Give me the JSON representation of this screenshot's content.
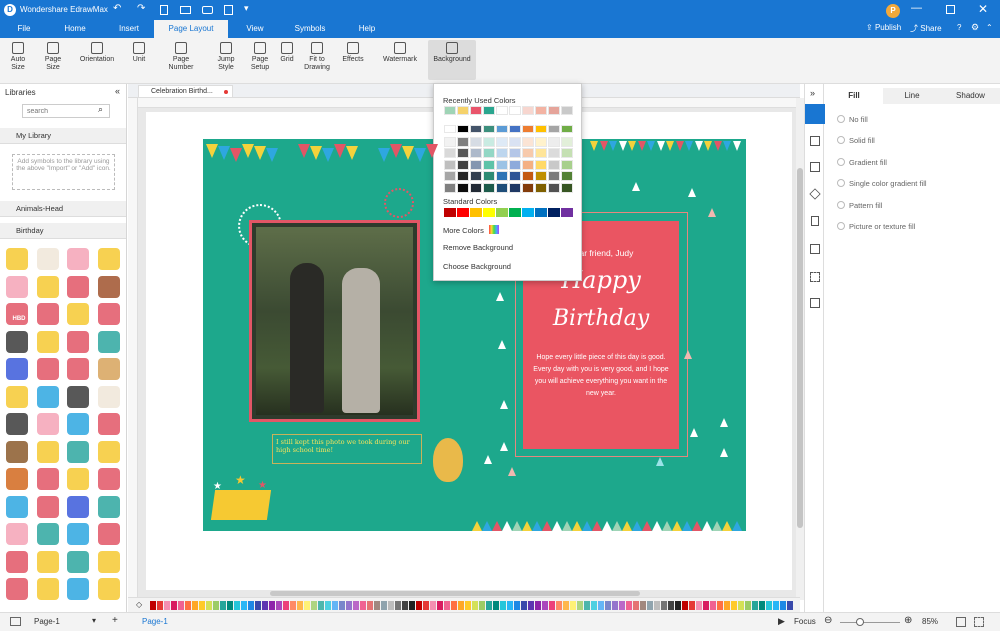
{
  "app": {
    "title": "Wondershare EdrawMax",
    "user_initial": "P",
    "publish": "Publish",
    "share": "Share"
  },
  "menu": {
    "file": "File",
    "home": "Home",
    "insert": "Insert",
    "page_layout": "Page Layout",
    "view": "View",
    "symbols": "Symbols",
    "help": "Help"
  },
  "ribbon": {
    "auto_size": "Auto Size",
    "page_size": "Page Size",
    "orientation": "Orientation",
    "unit": "Unit",
    "page_number": "Page Number",
    "jump_style": "Jump Style",
    "page_setup": "Page Setup",
    "grid": "Grid",
    "fit_to_drawing": "Fit to Drawing",
    "effects": "Effects",
    "watermark": "Watermark",
    "background": "Background"
  },
  "libraries": {
    "title": "Libraries",
    "search_placeholder": "search",
    "my_library": "My Library",
    "my_library_hint": "Add symbols to the library using the above \"Import\" or \"Add\" icon.",
    "animals_head": "Animals-Head",
    "birthday": "Birthday",
    "hbd": "HBD"
  },
  "tab": {
    "name": "Celebration Birthd..."
  },
  "dropdown": {
    "recently_used": "Recently Used Colors",
    "standard": "Standard Colors",
    "more_colors": "More Colors",
    "remove_background": "Remove Background",
    "choose_background": "Choose Background",
    "recent_colors": [
      "#9fd4b6",
      "#f5d26b",
      "#e9556b",
      "#2aa68f",
      "#ffffff",
      "#ffffff",
      "#f7d6cf",
      "#f3b3a3",
      "#e5a49a",
      "#c9c9c9"
    ],
    "standard_colors": [
      "#c00000",
      "#ff0000",
      "#ffc000",
      "#ffff00",
      "#92d050",
      "#00b050",
      "#00b0f0",
      "#0070c0",
      "#002060",
      "#7030a0"
    ]
  },
  "card": {
    "greeting": "Dear friend, Judy",
    "happy": "Happy",
    "birthday": "Birthday",
    "message": "Hope every little piece of this day is good.\nEvery day with you is very good, and I hope you will achieve everything you want in the new year.",
    "caption": "I still kept this photo we took during our high school time!"
  },
  "right_panel": {
    "tab_fill": "Fill",
    "tab_line": "Line",
    "tab_shadow": "Shadow",
    "options": [
      "No fill",
      "Solid fill",
      "Gradient fill",
      "Single color gradient fill",
      "Pattern fill",
      "Picture or texture fill"
    ]
  },
  "status": {
    "page_select": "Page-1",
    "page_tab": "Page-1",
    "focus": "Focus",
    "zoom": "85%"
  },
  "colors": {
    "primary": "#1976d2",
    "card_green": "#1da88c",
    "card_pink": "#ea5562"
  }
}
